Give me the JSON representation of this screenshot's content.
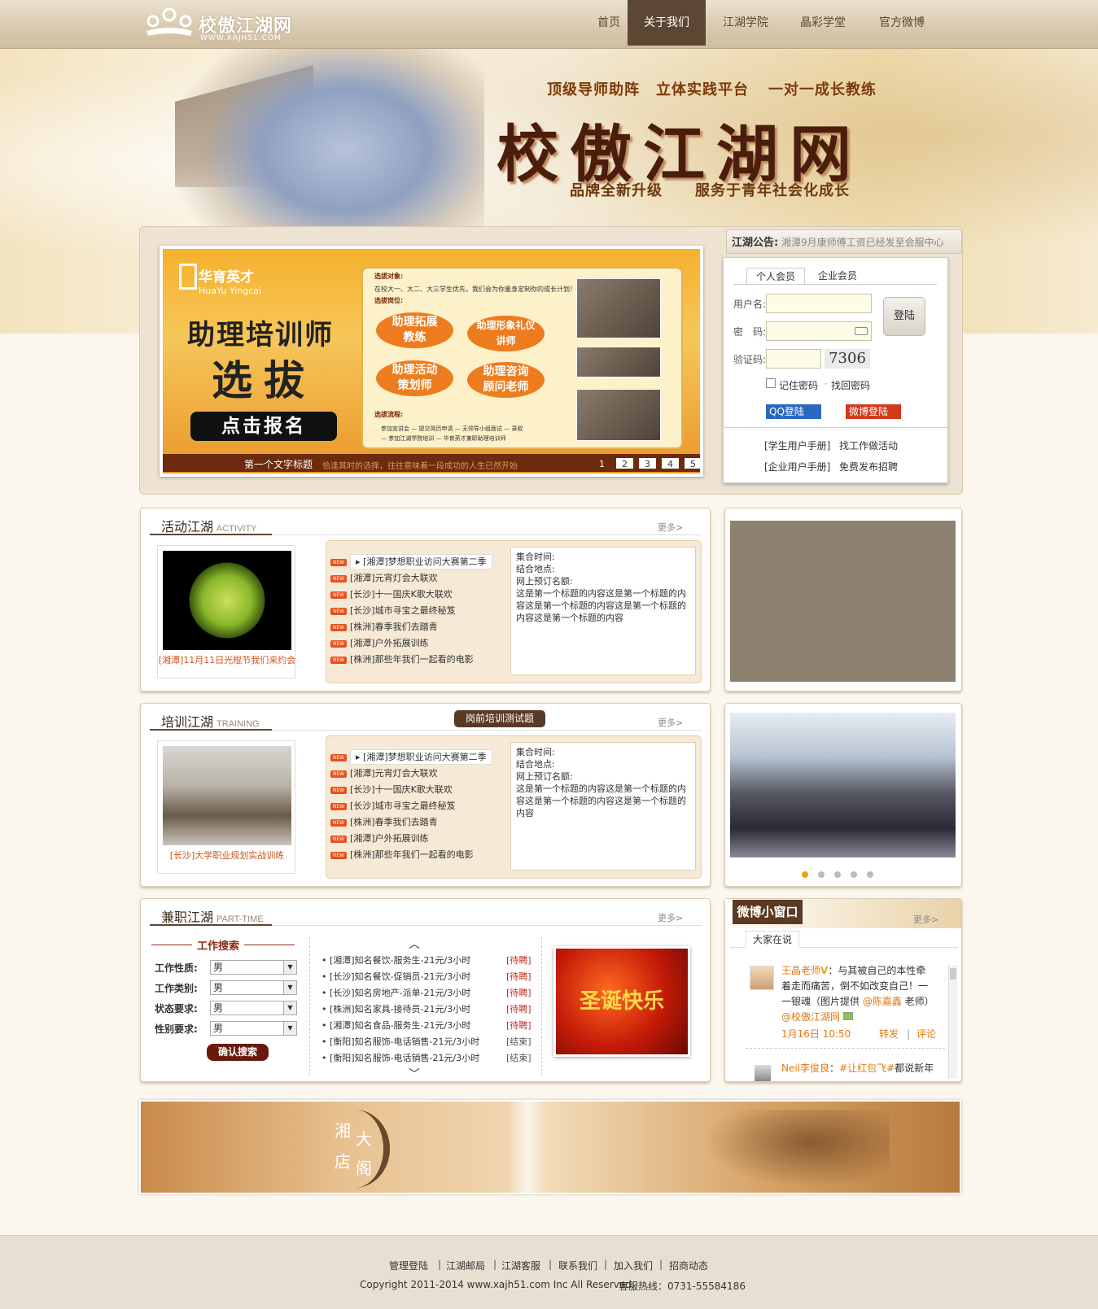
{
  "header": {
    "logo_text": "校傲江湖网",
    "logo_url": "WWW.XAJH51.COM",
    "nav": [
      "首页",
      "关于我们",
      "江湖学院",
      "晶彩学堂",
      "官方微博"
    ],
    "active_nav": "关于我们"
  },
  "hero": {
    "tagline1": "顶级导师助阵",
    "tagline2": "立体实践平台",
    "tagline3": "一对一成长教练",
    "title": "校傲江湖网",
    "slogan1": "品牌全新升级",
    "slogan2": "服务于青年社会化成长"
  },
  "slider": {
    "brand_cn": "华育英才",
    "brand_en": "HuaYu Yingcai",
    "headline1": "助理培训师",
    "headline2": "选拔",
    "cta": "点击报名",
    "target_label": "选拔对象:",
    "target_text": "在校大一、大二、大三学生优先，我们会为你量身定制你的成长计划！",
    "posts_label": "选拔岗位:",
    "posts": [
      "助理拓展\n教练",
      "助理形象礼仪\n讲师",
      "助理活动\n策划师",
      "助理咨询\n顾问老师"
    ],
    "flow_label": "选拔流程:",
    "flow1": "参加宣讲会 — 提交简历申请 — 无领导小组面试 — 录取",
    "flow2": "— 参加江湖学院培训 — 华育英才兼职助理培训师",
    "caption": "第一个文字标题",
    "caption_sub": "恰逢其时的选择，往往意味着一段成功的人生已然开始",
    "pages": [
      "1",
      "2",
      "3",
      "4",
      "5"
    ]
  },
  "notice": {
    "label": "江湖公告:",
    "text": "湘潭9月康师傅工资已经发至会服中心"
  },
  "login": {
    "tabs": [
      "个人会员",
      "企业会员"
    ],
    "username_label": "用户名:",
    "password_label": "密　码:",
    "captcha_label": "验证码:",
    "captcha": "7306",
    "login_button": "登陆",
    "remember": "记住密码",
    "find": "找回密码",
    "qq": "QQ登陆",
    "weibo": "微博登陆",
    "link1": "[学生用户手册]",
    "link2": "找工作做活动",
    "link3": "[企业用户手册]",
    "link4": "免费发布招聘"
  },
  "activity": {
    "title": "活动江湖",
    "title_en": "ACTIVITY",
    "more": "更多>",
    "thumb_caption": "[湘潭]11月11日光棍节我们来约会",
    "items": [
      "[湘潭]梦想职业访问大赛第二季",
      "[湘潭]元宵灯会大联欢",
      "[长沙]十一国庆K歌大联欢",
      "[长沙]城市寻宝之最终秘笈",
      "[株洲]春季我们去踏青",
      "[湘潭]户外拓展训练",
      "[株洲]那些年我们一起看的电影"
    ],
    "new_badge": "NEW",
    "detail": [
      "集合时间:",
      "结合地点:",
      "网上预订名额:",
      "这是第一个标题的内容这是第一个标题的内容这是第一个标题的内容这是第一个标题的内容这是第一个标题的内容"
    ]
  },
  "training": {
    "title": "培训江湖",
    "title_en": "TRAINING",
    "test_button": "岗前培训测试题",
    "more": "更多>",
    "thumb_caption": "[长沙]大学职业规划实战训练",
    "items": [
      "[湘潭]梦想职业访问大赛第二季",
      "[湘潭]元宵灯会大联欢",
      "[长沙]十一国庆K歌大联欢",
      "[长沙]城市寻宝之最终秘笈",
      "[株洲]春季我们去踏青",
      "[湘潭]户外拓展训练",
      "[株洲]那些年我们一起看的电影"
    ],
    "detail": [
      "集合时间:",
      "结合地点:",
      "网上预订名额:",
      "这是第一个标题的内容这是第一个标题的内容这是第一个标题的内容这是第一个标题的内容"
    ]
  },
  "parttime": {
    "title": "兼职江湖",
    "title_en": "PART-TIME",
    "more": "更多>",
    "search_title": "工作搜索",
    "fields": [
      {
        "label": "工作性质:",
        "value": "男"
      },
      {
        "label": "工作类别:",
        "value": "男"
      },
      {
        "label": "状态要求:",
        "value": "男"
      },
      {
        "label": "性别要求:",
        "value": "男"
      }
    ],
    "search_button": "确认搜索",
    "jobs": [
      {
        "text": "[湘潭]知名餐饮-服务生-21元/3小时",
        "status": "[待聘]"
      },
      {
        "text": "[长沙]知名餐饮-促销员-21元/3小时",
        "status": "[待聘]"
      },
      {
        "text": "[长沙]知名房地产-派单-21元/3小时",
        "status": "[待聘]"
      },
      {
        "text": "[株洲]知名家具-接待员-21元/3小时",
        "status": "[待聘]"
      },
      {
        "text": "[湘潭]知名食品-服务生-21元/3小时",
        "status": "[待聘]"
      },
      {
        "text": "[衡阳]知名服饰-电话销售-21元/3小时",
        "status": "[结束]"
      },
      {
        "text": "[衡阳]知名服饰-电话销售-21元/3小时",
        "status": "[结束]"
      }
    ],
    "promo_text": "圣诞快乐"
  },
  "weibo": {
    "title": "微博小窗口",
    "more": "更多>",
    "tab": "大家在说",
    "user": "王晶老师",
    "post1": "：与其被自己的本性牵",
    "post2": "着走而痛苦，倒不如改变自己！一",
    "post3": "一银魂（图片提供 ",
    "mention": "@陈嘉鑫",
    "post3b": " 老师）",
    "mention2": "@校傲江湖网",
    "time": "1月16日 10:50",
    "forward": "转发",
    "comment": "评论",
    "user2": "Neil李俊良",
    "post4": "：",
    "tag": "#让红包飞#",
    "post4b": "都说新年"
  },
  "banner": {
    "text1": "湘",
    "text2": "大",
    "text3": "店",
    "text4": "阁"
  },
  "footer": {
    "links": [
      "管理登陆",
      "江湖邮局",
      "江湖客服",
      "联系我们",
      "加入我们",
      "招商动态"
    ],
    "copyright": "Copyright 2011-2014 www.xajh51.com Inc All Reserved.",
    "hotline": "客服热线：0731-55584186"
  }
}
